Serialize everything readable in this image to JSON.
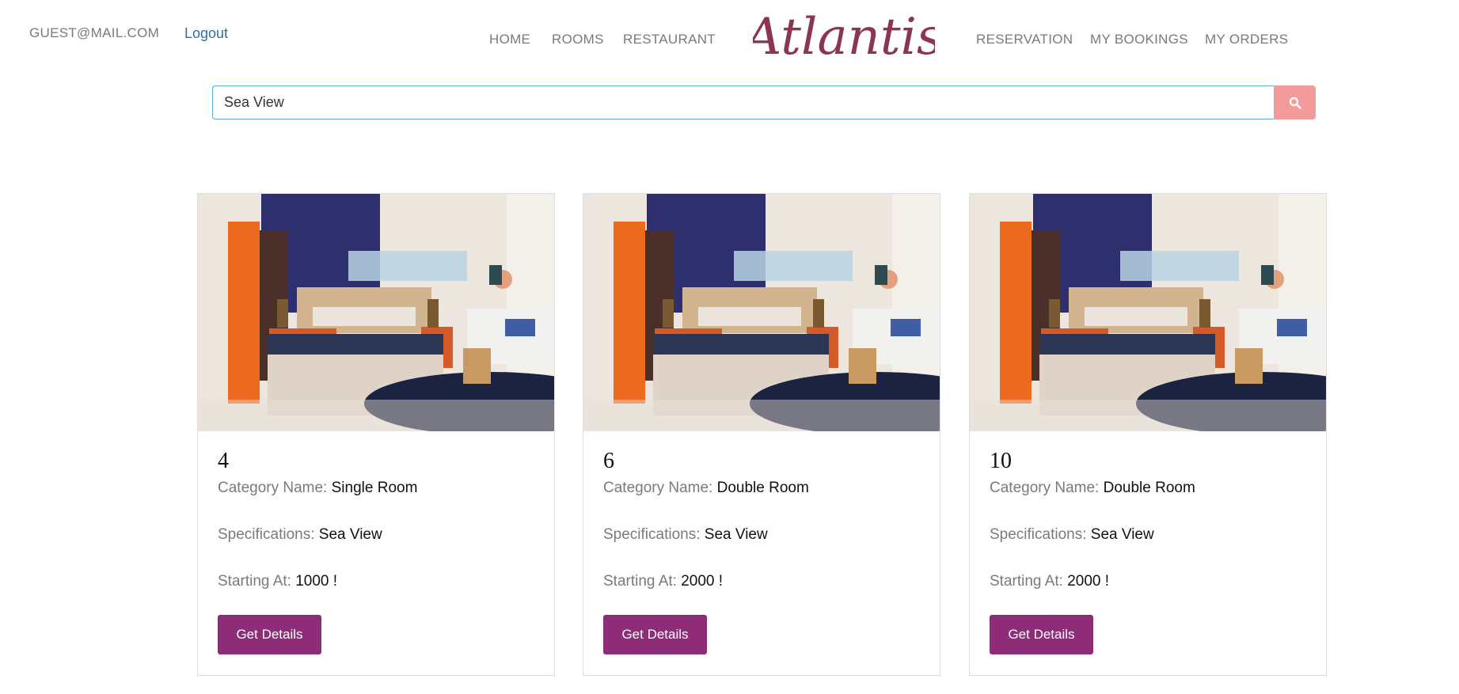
{
  "header": {
    "user_email": "GUEST@MAIL.COM",
    "logout_label": "Logout",
    "brand": "Atlantis",
    "brand_color": "#8b3550",
    "nav_left": [
      "HOME",
      "ROOMS",
      "RESTAURANT"
    ],
    "nav_right": [
      "RESERVATION",
      "MY BOOKINGS",
      "MY ORDERS"
    ]
  },
  "search": {
    "value": "Sea View",
    "button_icon": "search-icon",
    "button_color": "#f39a9a"
  },
  "labels": {
    "category": "Category Name:",
    "specifications": "Specifications:",
    "starting_at": "Starting At:",
    "details_button": "Get Details"
  },
  "rooms": [
    {
      "number": "4",
      "category": "Single Room",
      "specifications": "Sea View",
      "price": "1000 !"
    },
    {
      "number": "6",
      "category": "Double Room",
      "specifications": "Sea View",
      "price": "2000 !"
    },
    {
      "number": "10",
      "category": "Double Room",
      "specifications": "Sea View",
      "price": "2000 !"
    }
  ],
  "accent_color": "#8e2c78"
}
